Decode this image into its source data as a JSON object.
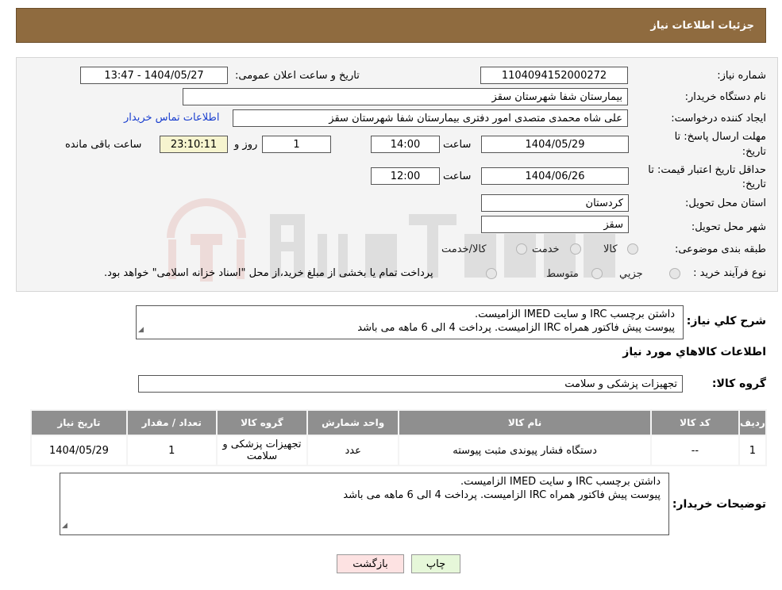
{
  "header": {
    "title": "جزئیات اطلاعات نیاز"
  },
  "form": {
    "need_number_label": "شماره نیاز:",
    "need_number": "1104094152000272",
    "announce_label": "تاریخ و ساعت اعلان عمومی:",
    "announce_value": "1404/05/27 - 13:47",
    "buyer_org_label": "نام دستگاه خریدار:",
    "buyer_org": "بیمارستان شفا شهرستان سقز",
    "creator_label": "ایجاد کننده درخواست:",
    "creator": "علی شاه محمدی متصدی امور دفتری بیمارستان شفا شهرستان سقز",
    "contact_link": "اطلاعات تماس خریدار",
    "send_deadline_label_1": "مهلت ارسال پاسخ: تا",
    "send_deadline_label_2": "تاریخ:",
    "send_date": "1404/05/29",
    "time_label": "ساعت",
    "send_time": "14:00",
    "days": "1",
    "days_label": "روز و",
    "remaining_time": "23:10:11",
    "remaining_label": "ساعت باقی مانده",
    "validity_label_1": "حداقل تاریخ اعتبار قیمت: تا",
    "validity_label_2": "تاریخ:",
    "validity_date": "1404/06/26",
    "validity_time": "12:00",
    "province_label": "استان محل تحویل:",
    "province": "کردستان",
    "city_label": "شهر محل تحویل:",
    "city": "سقز",
    "category_label": "طبقه بندی موضوعی:",
    "category_options": [
      "کالا",
      "خدمت",
      "کالا/خدمت"
    ],
    "purchase_type_label": "نوع فرآیند خرید :",
    "purchase_options": [
      "جزیي",
      "متوسط"
    ],
    "purchase_note": "پرداخت تمام یا بخشی از مبلغ خرید،از محل \"اسناد خزانه اسلامی\" خواهد بود."
  },
  "description": {
    "label": "شرح کلي نياز:",
    "line1": "داشتن برچسب IRC و سایت IMED الزامیست.",
    "line2": "پیوست پیش فاکتور همراه IRC الزامیست. پرداخت 4 الی 6 ماهه می باشد"
  },
  "goods_section": {
    "title": "اطلاعات کالاهاي مورد نياز",
    "group_label": "گروه کالا:",
    "group_value": "تجهیزات پزشکی و سلامت"
  },
  "table": {
    "headers": [
      "ردیف",
      "کد کالا",
      "نام کالا",
      "واحد شمارش",
      "گروه کالا",
      "تعداد / مقدار",
      "تاریخ نیاز"
    ],
    "rows": [
      [
        "1",
        "--",
        "دستگاه فشار پیوندی مثبت پیوسته",
        "عدد",
        "تجهیزات پزشکی و سلامت",
        "1",
        "1404/05/29"
      ]
    ]
  },
  "buyer_notes": {
    "label": "توضیحات خریدار:",
    "line1": "داشتن برچسب IRC و سایت IMED الزامیست.",
    "line2": "پیوست پیش فاکتور همراه IRC الزامیست. پرداخت 4 الی 6 ماهه می باشد"
  },
  "buttons": {
    "print": "چاپ",
    "back": "بازگشت"
  },
  "colors": {
    "header_bg": "#8f6b3f",
    "table_header_bg": "#8f8f8f",
    "back_btn_bg": "#fde2e2",
    "print_btn_bg": "#e6f7d9",
    "timer_bg": "#f6f4cf"
  }
}
